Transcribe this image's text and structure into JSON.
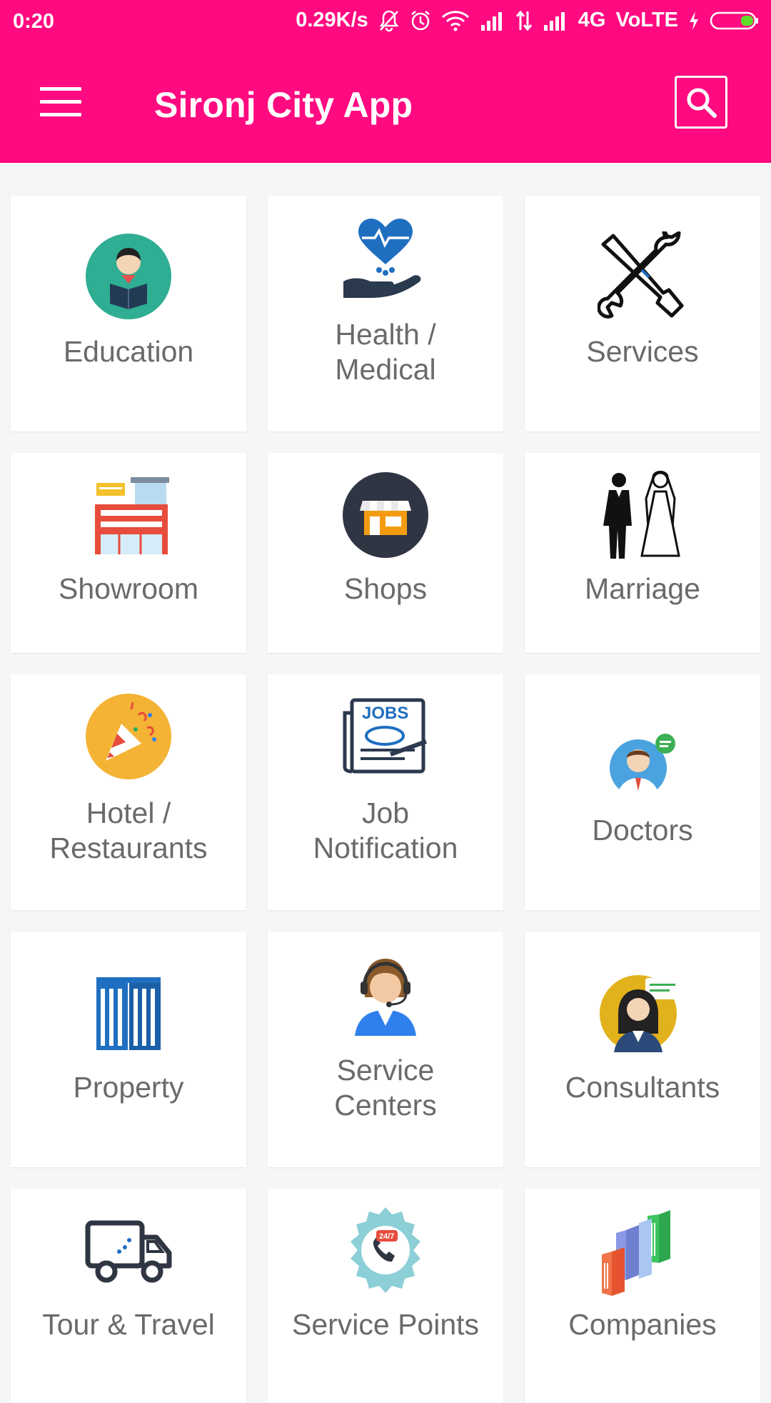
{
  "status_bar": {
    "time": "0:20",
    "net_speed": "0.29K/s",
    "network": "4G",
    "volte": "VoLTE"
  },
  "app_bar": {
    "title": "Sironj City App"
  },
  "colors": {
    "primary": "#ff0a80",
    "label_text": "#6a6a6a",
    "card_bg": "#ffffff",
    "page_bg": "#f6f6f6"
  },
  "categories": [
    {
      "label": "Education",
      "icon": "education-icon"
    },
    {
      "label": "Health /\nMedical",
      "icon": "health-icon"
    },
    {
      "label": "Services",
      "icon": "tools-icon"
    },
    {
      "label": "Showroom",
      "icon": "showroom-icon"
    },
    {
      "label": "Shops",
      "icon": "shop-icon"
    },
    {
      "label": "Marriage",
      "icon": "couple-icon"
    },
    {
      "label": "Hotel  /\nRestaurants",
      "icon": "party-icon"
    },
    {
      "label": "Job\nNotification",
      "icon": "jobs-newspaper-icon"
    },
    {
      "label": "Doctors",
      "icon": "doctor-icon"
    },
    {
      "label": "Property",
      "icon": "building-icon"
    },
    {
      "label": "Service\nCenters",
      "icon": "call-agent-icon"
    },
    {
      "label": "Consultants",
      "icon": "consultant-icon"
    },
    {
      "label": "Tour & Travel",
      "icon": "truck-icon"
    },
    {
      "label": "Service Points",
      "icon": "support-24-7-icon"
    },
    {
      "label": "Companies",
      "icon": "companies-icon"
    }
  ]
}
